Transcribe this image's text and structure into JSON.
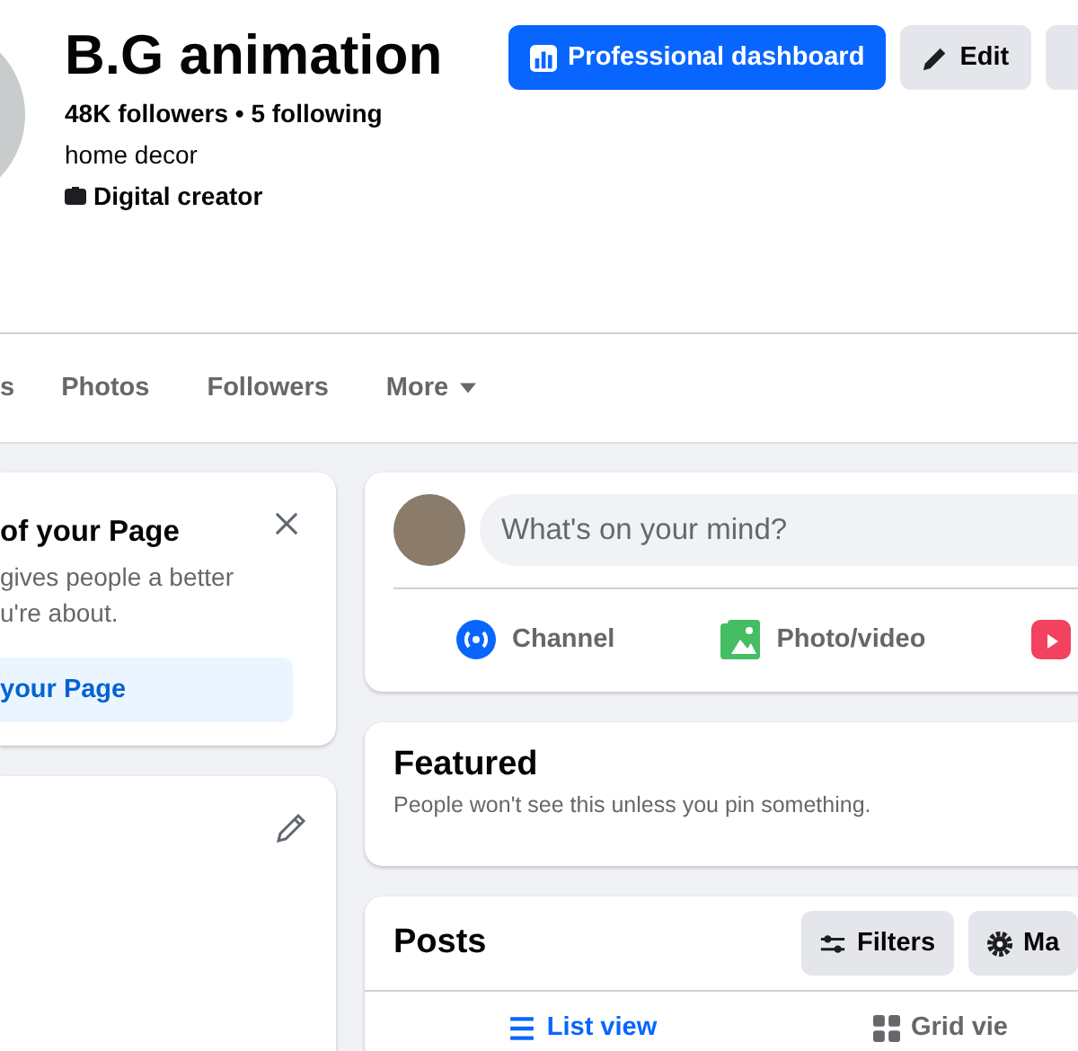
{
  "profile": {
    "name": "B.G animation",
    "stats": "48K followers • 5 following",
    "bio": "home decor",
    "category": "Digital creator"
  },
  "actions": [
    {
      "kind": "primary",
      "label": "Professional dashboard"
    },
    {
      "kind": "edit",
      "label": "Edit"
    }
  ],
  "tabs": [
    {
      "label": "s"
    },
    {
      "label": "Photos"
    },
    {
      "label": "Followers"
    },
    {
      "label": "More",
      "dropdown": true
    }
  ],
  "setup_card": {
    "title": "of your Page",
    "description": "gives people a better\nu're about.",
    "button": "your Page"
  },
  "composer": {
    "placeholder": "What's on your mind?",
    "options": [
      {
        "kind": "channel",
        "label": "Channel"
      },
      {
        "kind": "photo",
        "label": "Photo/video"
      },
      {
        "kind": "reel"
      }
    ]
  },
  "featured": {
    "title": "Featured",
    "description": "People won't see this unless you pin something."
  },
  "posts": {
    "title": "Posts",
    "buttons": [
      {
        "kind": "filters",
        "label": "Filters"
      },
      {
        "kind": "manage",
        "label": "Ma"
      }
    ],
    "views": [
      {
        "kind": "list",
        "label": "List view",
        "selected": true
      },
      {
        "kind": "grid",
        "label": "Grid vie",
        "selected": false
      }
    ]
  }
}
